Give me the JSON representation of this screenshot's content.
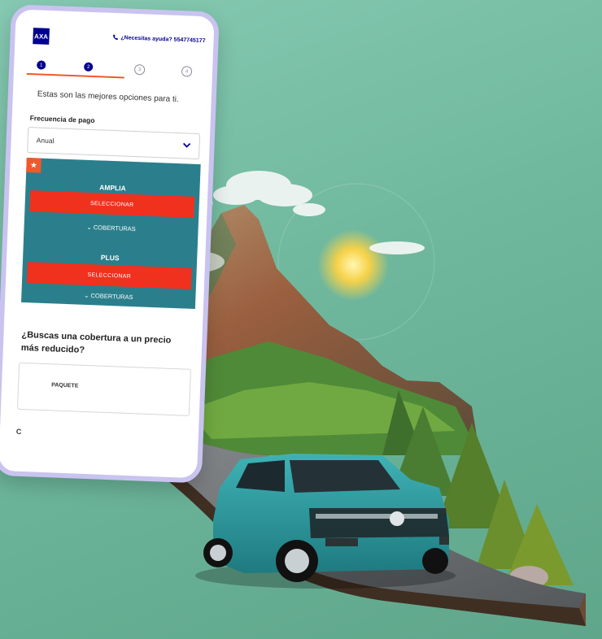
{
  "phone": {
    "brand_logo": "AXA",
    "help_text": "¿Necesitas ayuda? 5547745177",
    "steps": [
      "1",
      "2",
      "3",
      "4"
    ],
    "current_step": 2,
    "intro_text": "Estas son las mejores opciones para ti.",
    "frequency": {
      "label": "Frecuencia de pago",
      "selected": "Anual"
    },
    "plans": [
      {
        "name": "AMPLIA",
        "button": "SELECCIONAR",
        "coverage": "COBERTURAS",
        "recommended": true
      },
      {
        "name": "PLUS",
        "button": "SELECCIONAR",
        "coverage": "COBERTURAS",
        "recommended": false
      }
    ],
    "cheaper_question": "¿Buscas una cobertura a un precio más reducido?",
    "package_label": "PAQUETE",
    "footer_partial": "C"
  },
  "illustration": {
    "subject": "teal compact SUV on a road leading to a mountain with sun and clouds"
  },
  "colors": {
    "background": "#74bfa4",
    "brand_blue": "#00008f",
    "plan_teal": "#2b7f8c",
    "cta_red": "#f0311e",
    "phone_frame": "#c9c3f0"
  }
}
